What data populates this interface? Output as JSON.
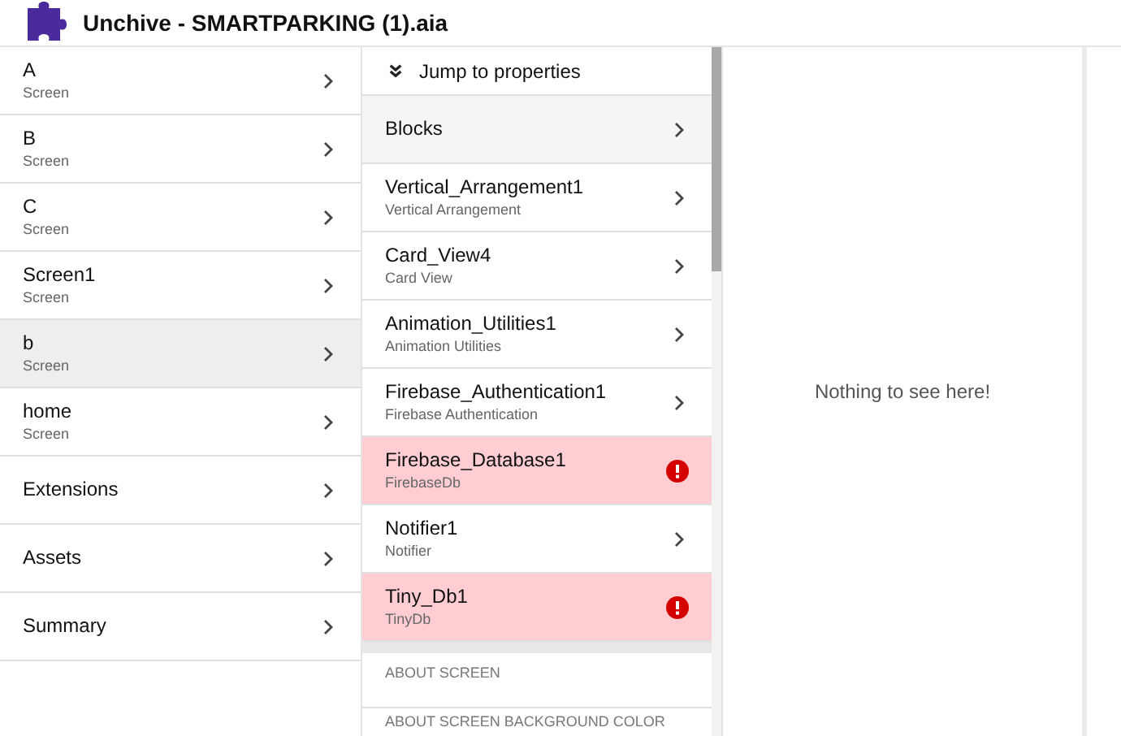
{
  "window": {
    "title": "Unchive - SMARTPARKING (1).aia"
  },
  "sidebar": {
    "items": [
      {
        "label": "A",
        "subtitle": "Screen",
        "selected": false
      },
      {
        "label": "B",
        "subtitle": "Screen",
        "selected": false
      },
      {
        "label": "C",
        "subtitle": "Screen",
        "selected": false
      },
      {
        "label": "Screen1",
        "subtitle": "Screen",
        "selected": false
      },
      {
        "label": "b",
        "subtitle": "Screen",
        "selected": true
      },
      {
        "label": "home",
        "subtitle": "Screen",
        "selected": false
      },
      {
        "label": "Extensions",
        "selected": false
      },
      {
        "label": "Assets",
        "selected": false
      },
      {
        "label": "Summary",
        "selected": false
      }
    ]
  },
  "components": {
    "jump_link": "Jump to properties",
    "blocks": "Blocks",
    "items": [
      {
        "name": "Vertical_Arrangement1",
        "type": "Vertical Arrangement",
        "error": false
      },
      {
        "name": "Card_View4",
        "type": "Card View",
        "error": false
      },
      {
        "name": "Animation_Utilities1",
        "type": "Animation Utilities",
        "error": false
      },
      {
        "name": "Firebase_Authentication1",
        "type": "Firebase Authentication",
        "error": false
      },
      {
        "name": "Firebase_Database1",
        "type": "FirebaseDb",
        "error": true
      },
      {
        "name": "Notifier1",
        "type": "Notifier",
        "error": false
      },
      {
        "name": "Tiny_Db1",
        "type": "TinyDb",
        "error": true
      }
    ],
    "sections": [
      "ABOUT SCREEN",
      "ABOUT SCREEN BACKGROUND COLOR"
    ]
  },
  "details": {
    "empty_message": "Nothing to see here!"
  }
}
